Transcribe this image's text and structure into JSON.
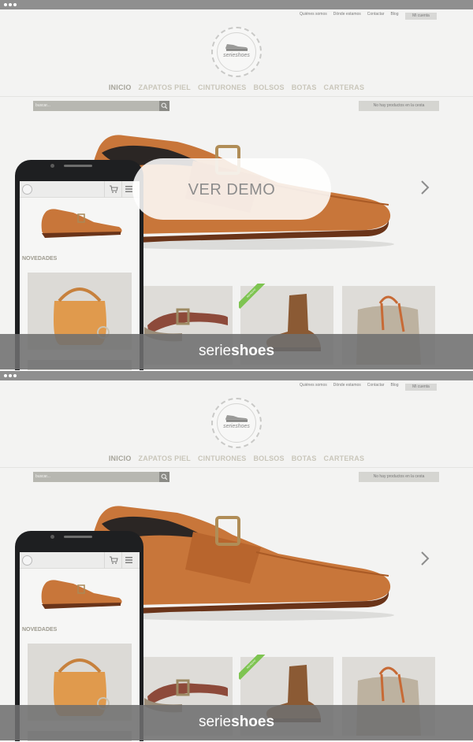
{
  "panels": [
    {
      "top_links": [
        "Quiénes somos",
        "Dónde estamos",
        "Contactar",
        "Blog"
      ],
      "account_label": "Mi cuenta",
      "logo_text": "serieshoes",
      "nav": [
        "INICIO",
        "ZAPATOS PIEL",
        "CINTURONES",
        "BOLSOS",
        "BOTAS",
        "CARTERAS"
      ],
      "search_placeholder": "buscar...",
      "cart_status": "No hay productos en la cesta",
      "ribbon_label": "NOVEDAD",
      "mobile": {
        "section_title": "NOVEDADES"
      },
      "brand": {
        "light": "serie",
        "bold": "shoes"
      },
      "demo_label": "VER DEMO"
    },
    {
      "top_links": [
        "Quiénes somos",
        "Dónde estamos",
        "Contactar",
        "Blog"
      ],
      "account_label": "Mi cuenta",
      "logo_text": "serieshoes",
      "nav": [
        "INICIO",
        "ZAPATOS PIEL",
        "CINTURONES",
        "BOLSOS",
        "BOTAS",
        "CARTERAS"
      ],
      "search_placeholder": "buscar...",
      "cart_status": "No hay productos en la cesta",
      "ribbon_label": "NOVEDAD",
      "mobile": {
        "section_title": "NOVEDADES"
      },
      "brand": {
        "light": "serie",
        "bold": "shoes"
      }
    }
  ],
  "colors": {
    "browser_bar": "#8f8f8f",
    "page_bg": "#f3f3f2",
    "nav_text": "#c9c6ba",
    "shoe_leather": "#c8763a",
    "brand_band": "#707070",
    "ribbon": "#7ec451"
  },
  "icons": [
    "search-icon",
    "chevron-right-icon",
    "cart-icon",
    "menu-icon",
    "shoe-logo-icon"
  ]
}
